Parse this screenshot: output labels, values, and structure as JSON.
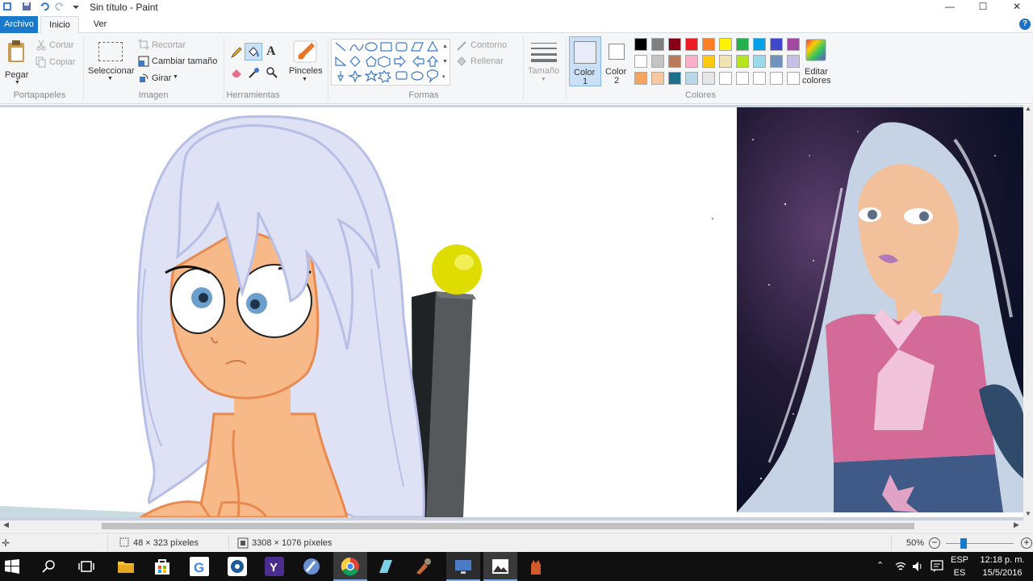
{
  "window": {
    "title": "Sin título - Paint",
    "minimize": "—",
    "maximize": "☐",
    "close": "✕"
  },
  "tabs": {
    "file": "Archivo",
    "home": "Inicio",
    "view": "Ver",
    "help": "?"
  },
  "clipboard": {
    "paste": "Pegar",
    "cut": "Cortar",
    "copy": "Copiar",
    "group": "Portapapeles"
  },
  "image": {
    "select": "Seleccionar",
    "crop": "Recortar",
    "resize": "Cambiar tamaño",
    "rotate": "Girar",
    "group": "Imagen"
  },
  "tools": {
    "group": "Herramientas",
    "text": "A"
  },
  "brushes": {
    "label": "Pinceles"
  },
  "shapes": {
    "outline": "Contorno",
    "fill": "Rellenar",
    "group": "Formas"
  },
  "size": {
    "label": "Tamaño"
  },
  "colors": {
    "color1": "Color 1",
    "color1_a": "Color",
    "color1_b": "1",
    "color2_a": "Color",
    "color2_b": "2",
    "edit_a": "Editar",
    "edit_b": "colores",
    "group": "Colores",
    "color1_value": "#e8ecf8",
    "color2_value": "#ffffff",
    "row1": [
      "#000000",
      "#7f7f7f",
      "#880015",
      "#ed1c24",
      "#ff7f27",
      "#fff200",
      "#22b14c",
      "#00a2e8",
      "#3f48cc",
      "#a349a4"
    ],
    "row2": [
      "#ffffff",
      "#c3c3c3",
      "#b97a57",
      "#ffaec9",
      "#ffc90e",
      "#efe4b0",
      "#b5e61d",
      "#99d9ea",
      "#7092be",
      "#c8bfe7"
    ],
    "row3": [
      "#f4a460",
      "#f8c8a0",
      "#1f6f8b",
      "#b8d8e8",
      "#e6e6e6",
      "#ffffff",
      "#ffffff",
      "#ffffff",
      "#ffffff",
      "#ffffff"
    ]
  },
  "status": {
    "cursor": "48 × 323 píxeles",
    "selection": "3308 × 1076 píxeles",
    "zoom": "50%",
    "zoom_out": "−",
    "zoom_in": "+"
  },
  "taskbar": {
    "lang1": "ESP",
    "lang2": "ES",
    "time": "12:18 p. m.",
    "date": "15/5/2016"
  }
}
